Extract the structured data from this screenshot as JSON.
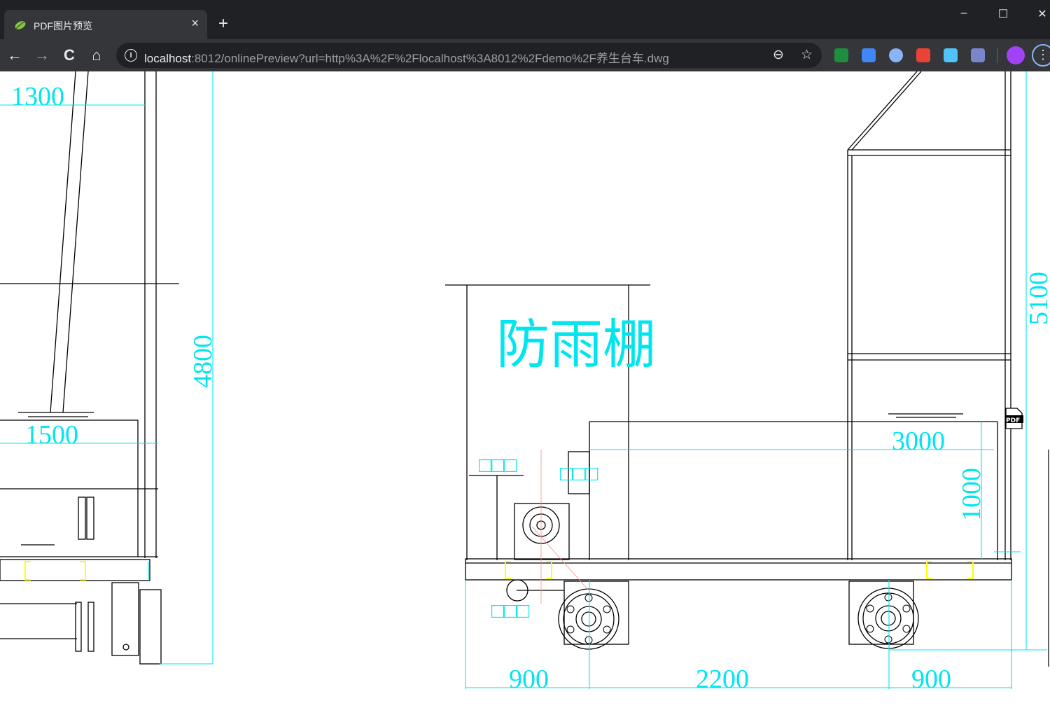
{
  "browser": {
    "tab_title": "PDF图片预览",
    "tab_close": "×",
    "new_tab": "+",
    "window_controls": [
      "–",
      "☐",
      "✕"
    ],
    "nav": {
      "back": "←",
      "forward": "→",
      "reload": "C",
      "home": "⌂"
    },
    "info_icon": "i",
    "url_host": "localhost",
    "url_rest": ":8012/onlinePreview?url=http%3A%2F%2Flocalhost%3A8012%2Fdemo%2F养生台车.dwg",
    "zoom_icon": "⊖",
    "star_icon": "☆",
    "menu": "⋮",
    "extension_colors": [
      "#1e8e3e",
      "#4285f4",
      "#8ab4f8",
      "#ea4335",
      "#4fc3f7",
      "#7986cb"
    ]
  },
  "drawing": {
    "accent_color": "#00e5ee",
    "line_color": "#000000",
    "dimensions_left": [
      "1300",
      "1500",
      "4800"
    ],
    "canopy_label": "防雨棚",
    "dimensions_right": [
      "3000",
      "1000",
      "5100",
      "900",
      "2200",
      "900"
    ],
    "placeholder_glyphs": "□□□",
    "pdf_badge": "PDF"
  }
}
